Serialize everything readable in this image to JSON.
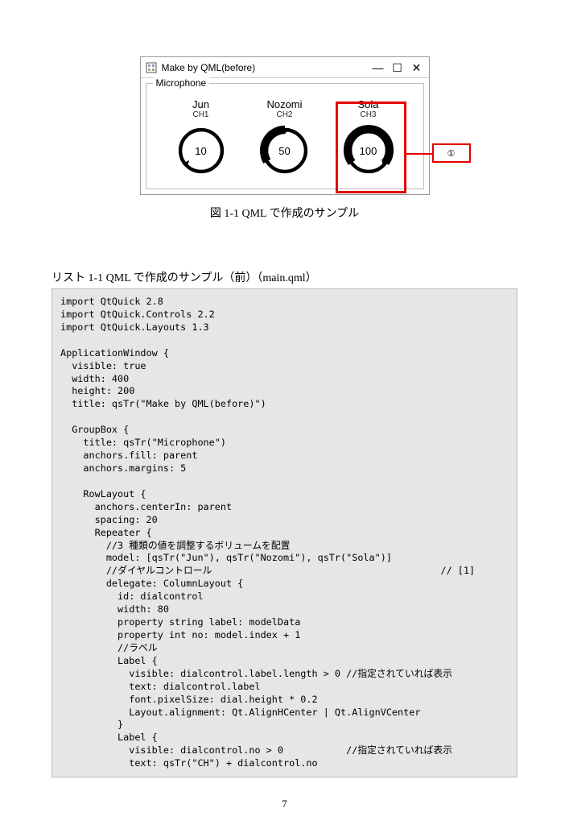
{
  "figure": {
    "window_title": "Make by QML(before)",
    "groupbox_title": "Microphone",
    "dials": [
      {
        "name": "Jun",
        "ch": "CH1",
        "value": "10"
      },
      {
        "name": "Nozomi",
        "ch": "CH2",
        "value": "50"
      },
      {
        "name": "Sola",
        "ch": "CH3",
        "value": "100"
      }
    ],
    "callout": "①",
    "caption": "図 1-1 QML で作成のサンプル"
  },
  "listing_title": "リスト 1-1 QML で作成のサンプル（前）（main.qml）",
  "code": "import QtQuick 2.8\nimport QtQuick.Controls 2.2\nimport QtQuick.Layouts 1.3\n\nApplicationWindow {\n  visible: true\n  width: 400\n  height: 200\n  title: qsTr(\"Make by QML(before)\")\n\n  GroupBox {\n    title: qsTr(\"Microphone\")\n    anchors.fill: parent\n    anchors.margins: 5\n\n    RowLayout {\n      anchors.centerIn: parent\n      spacing: 20\n      Repeater {\n        //3 種類の値を調整するボリュームを配置\n        model: [qsTr(\"Jun\"), qsTr(\"Nozomi\"), qsTr(\"Sola\")]\n        //ダイヤルコントロール                                        // [1]\n        delegate: ColumnLayout {\n          id: dialcontrol\n          width: 80\n          property string label: modelData\n          property int no: model.index + 1\n          //ラベル\n          Label {\n            visible: dialcontrol.label.length > 0 //指定されていれば表示\n            text: dialcontrol.label\n            font.pixelSize: dial.height * 0.2\n            Layout.alignment: Qt.AlignHCenter | Qt.AlignVCenter\n          }\n          Label {\n            visible: dialcontrol.no > 0           //指定されていれば表示\n            text: qsTr(\"CH\") + dialcontrol.no",
  "page_number": "7"
}
